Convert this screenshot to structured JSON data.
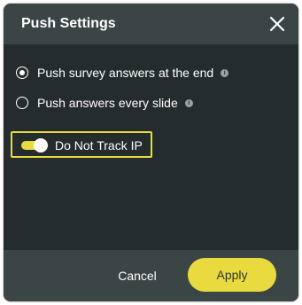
{
  "dialog": {
    "title": "Push Settings",
    "close_icon": "close-icon"
  },
  "options": [
    {
      "label": "Push survey answers at the end",
      "selected": true,
      "info_icon": "info-icon"
    },
    {
      "label": "Push answers every slide",
      "selected": false,
      "info_icon": "info-icon"
    }
  ],
  "track_ip": {
    "label": "Do Not Track IP",
    "enabled": true
  },
  "footer": {
    "cancel_label": "Cancel",
    "apply_label": "Apply"
  },
  "colors": {
    "accent": "#e9db3f",
    "panel": "#252c2d",
    "header": "#3c4546"
  }
}
